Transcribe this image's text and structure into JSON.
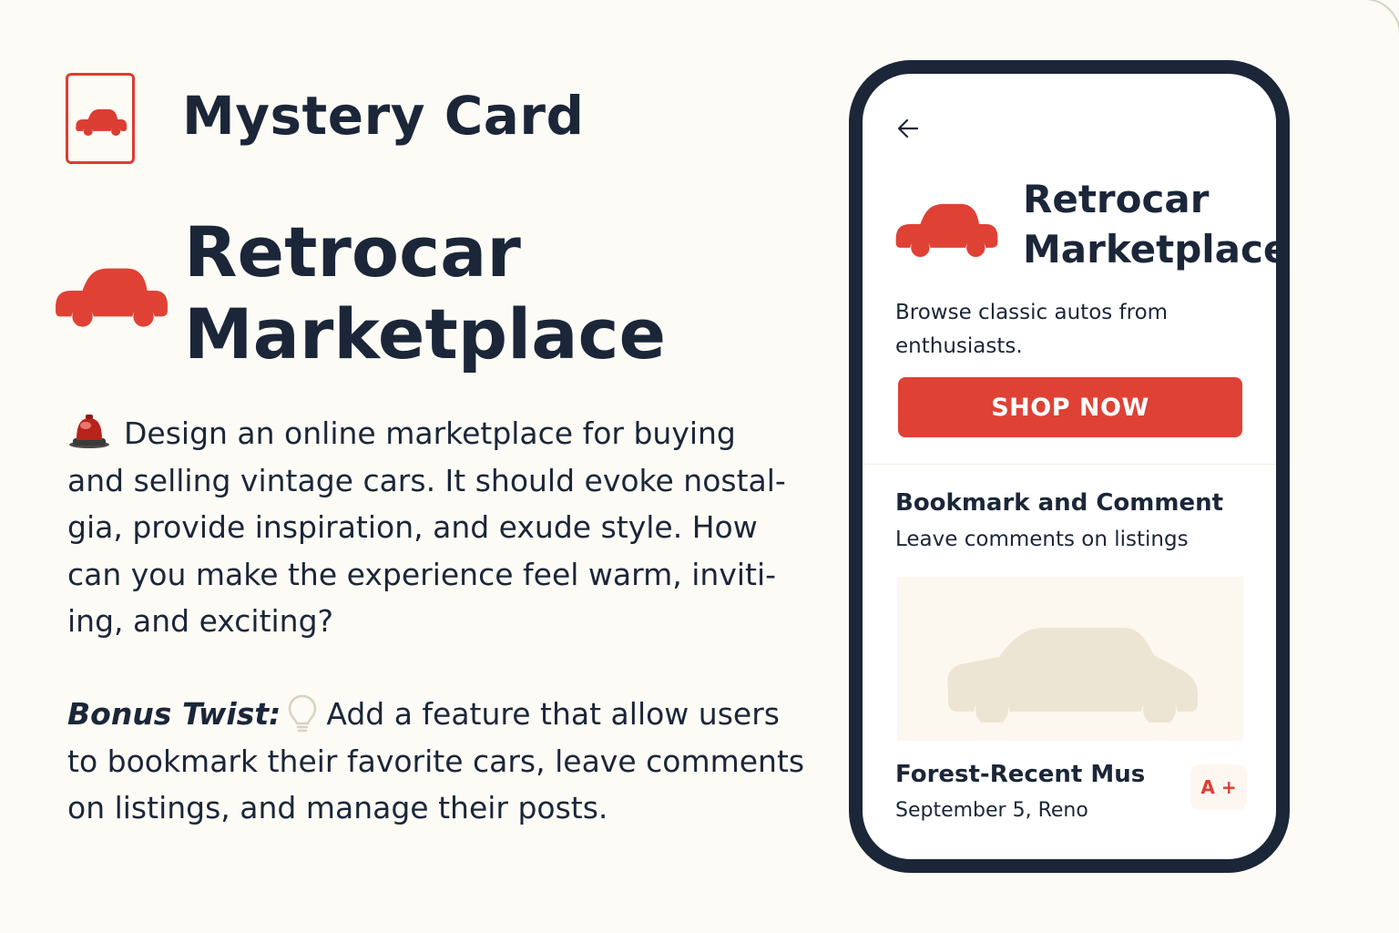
{
  "colors": {
    "accent": "#DF4135",
    "navy": "#1B2639",
    "background": "#FDFBF5",
    "placeholder_car": "#EDE5D3"
  },
  "card": {
    "header_title": "Mystery Card",
    "header_icon": "car-card-icon",
    "hero_title_line1": "Retrocar",
    "hero_title_line2": "Marketplace",
    "description_icon": "red-car-emoji-icon",
    "description": "Design an online marketplace for buying and selling vintage cars. It should evoke nostal­gia, provide inspiration, and exude style. How can you make the experience feel warm, inviti­ing, and exciting?",
    "bonus_label": "Bonus Twist:",
    "bonus_icon": "lightbulb-icon",
    "bonus_text": "Add a feature that allow users to bookmark their favorite cars, leave comments on listings, and manage their posts."
  },
  "phone": {
    "back_icon": "back-arrow-icon",
    "app_title_line1": "Retrocar",
    "app_title_line2": "Marketplace",
    "app_subtitle": "Browse classic autos from enthusiasts.",
    "shop_button_label": "SHOP NOW",
    "feature_title": "Bookmark and Comment",
    "feature_subtitle": "Leave comments on listings",
    "listing": {
      "title": "Forest-Recent Mus",
      "meta": "September 5, Reno",
      "badge": "A +"
    }
  }
}
